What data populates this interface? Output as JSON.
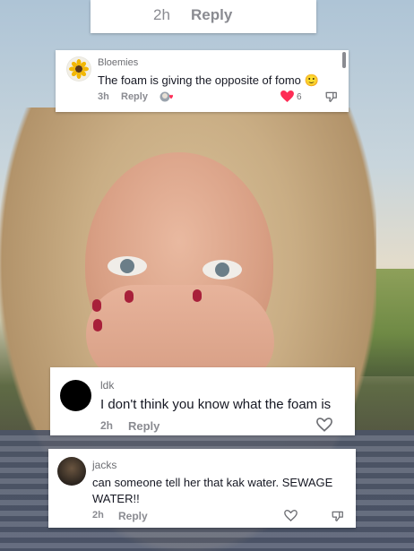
{
  "comments": [
    {
      "time": "2h",
      "reply_label": "Reply"
    },
    {
      "username": "Bloemies",
      "text": "The foam is giving the opposite of fomo",
      "emoji": "🙂",
      "time": "3h",
      "reply_label": "Reply",
      "likes": "6"
    },
    {
      "username": "ldk",
      "text": "I don't think you know what the foam is",
      "time": "2h",
      "reply_label": "Reply"
    },
    {
      "username": "jacks",
      "text": "can someone tell her that kak water. SEWAGE WATER!!",
      "time": "2h",
      "reply_label": "Reply"
    }
  ],
  "colors": {
    "like_active": "#fe2c55",
    "meta_text": "#8a8b91"
  }
}
